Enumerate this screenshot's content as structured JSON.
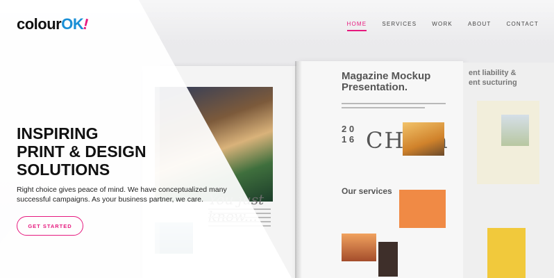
{
  "brand": {
    "word": "colour",
    "ok": "OK",
    "bang": "!",
    "colors": {
      "pink": "#e6197e",
      "blue": "#1a8fd6",
      "text": "#111111"
    }
  },
  "nav": {
    "items": [
      {
        "label": "HOME",
        "active": true
      },
      {
        "label": "SERVICES",
        "active": false
      },
      {
        "label": "WORK",
        "active": false
      },
      {
        "label": "ABOUT",
        "active": false
      },
      {
        "label": "CONTACT",
        "active": false
      }
    ]
  },
  "hero": {
    "headline": [
      "INSPIRING",
      "PRINT & DESIGN",
      "SOLUTIONS"
    ],
    "subtitle_lines": [
      "Right choice gives peace of mind. We have conceptualized many",
      "successful campaigns. As your business partner, we care."
    ],
    "cta_label": "GET STARTED"
  },
  "mockup": {
    "title_line1": "Magazine Mockup",
    "title_line2": "Presentation.",
    "year_line1": "2 0",
    "year_line2": "1 6",
    "china": "CHiNa",
    "services": "Our services",
    "script": "You just know...",
    "right_head_line1": "ent liability &",
    "right_head_line2": "ent sucturing"
  }
}
